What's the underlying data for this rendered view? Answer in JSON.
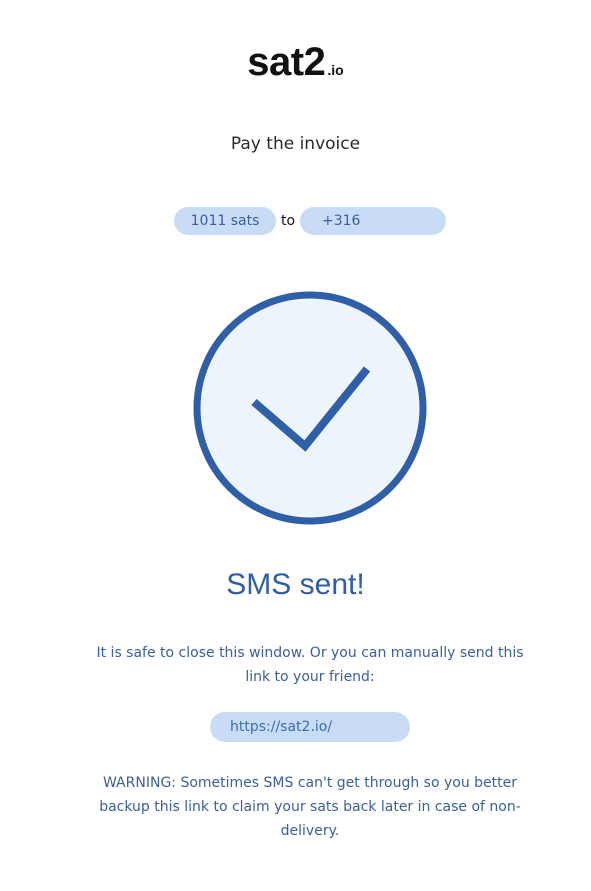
{
  "brand": {
    "name": "sat2",
    "tld": ".io"
  },
  "subtitle": "Pay the invoice",
  "amount": "1011 sats",
  "to_label": "to",
  "phone": "+316",
  "status": {
    "heading": "SMS sent!",
    "info": "It is safe to close this window. Or you can manually send this link to your friend:",
    "link": "https://sat2.io/",
    "warning": "WARNING: Sometimes SMS can't get through so you better backup this link to claim your sats back later in case of non-delivery."
  },
  "colors": {
    "accent": "#2f5fa7",
    "pill": "#c9dcf6",
    "circle_fill": "#eef4fc",
    "circle_stroke": "#2f5fa7"
  },
  "icons": {
    "success": "check-circle-icon"
  }
}
